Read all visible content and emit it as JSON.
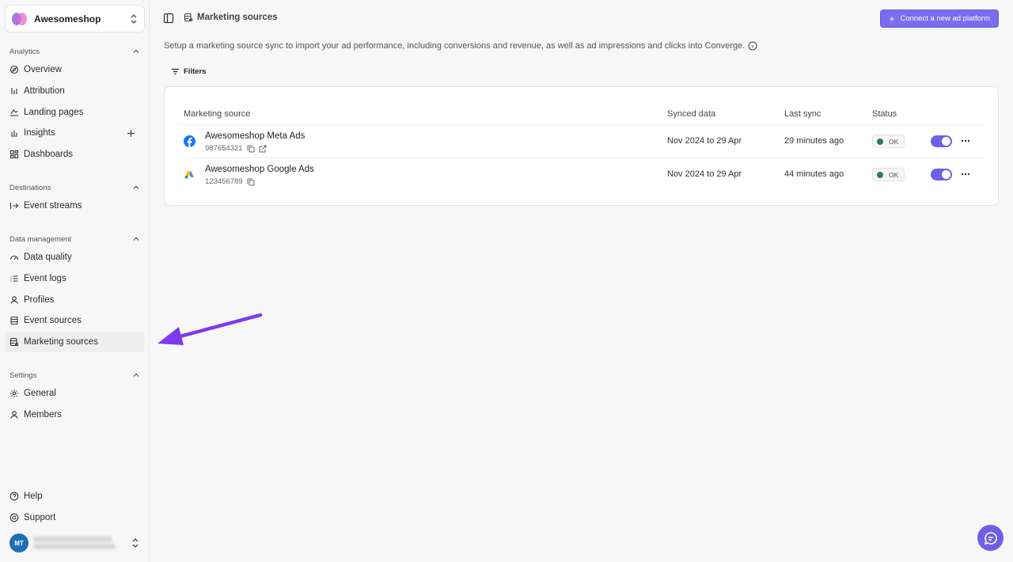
{
  "workspace": {
    "name": "Awesomeshop"
  },
  "sidebar": {
    "sections": [
      {
        "title": "Analytics",
        "items": [
          {
            "label": "Overview",
            "icon": "compass-icon"
          },
          {
            "label": "Attribution",
            "icon": "attribution-icon"
          },
          {
            "label": "Landing pages",
            "icon": "landing-icon"
          },
          {
            "label": "Insights",
            "icon": "bar-chart-icon"
          },
          {
            "label": "Dashboards",
            "icon": "grid-icon"
          }
        ]
      },
      {
        "title": "Destinations",
        "items": [
          {
            "label": "Event streams",
            "icon": "arrow-right-icon"
          }
        ]
      },
      {
        "title": "Data management",
        "items": [
          {
            "label": "Data quality",
            "icon": "gauge-icon"
          },
          {
            "label": "Event logs",
            "icon": "list-icon"
          },
          {
            "label": "Profiles",
            "icon": "user-icon"
          },
          {
            "label": "Event sources",
            "icon": "database-icon"
          },
          {
            "label": "Marketing sources",
            "icon": "database-gear-icon"
          }
        ]
      },
      {
        "title": "Settings",
        "items": [
          {
            "label": "General",
            "icon": "gear-icon"
          },
          {
            "label": "Members",
            "icon": "user-icon"
          }
        ]
      }
    ],
    "footer": {
      "help": "Help",
      "support": "Support",
      "user_initials": "MT"
    }
  },
  "header": {
    "breadcrumb": "Marketing sources",
    "connect_button": "Connect a new ad platform"
  },
  "description": "Setup a marketing source sync to import your ad performance, including conversions and revenue, as well as ad impressions and clicks into Converge.",
  "filters_label": "Filters",
  "table": {
    "columns": [
      "Marketing source",
      "Synced data",
      "Last sync",
      "Status"
    ],
    "rows": [
      {
        "name": "Awesomeshop Meta Ads",
        "id": "987654321",
        "synced": "Nov 2024 to 29 Apr",
        "last_sync": "29 minutes ago",
        "status": "OK",
        "enabled": true,
        "icon": "facebook-icon"
      },
      {
        "name": "Awesomeshop Google Ads",
        "id": "123456789",
        "synced": "Nov 2024 to 29 Apr",
        "last_sync": "44 minutes ago",
        "status": "OK",
        "enabled": true,
        "icon": "google-ads-icon"
      }
    ]
  },
  "colors": {
    "accent": "#7b6cf0",
    "status_ok": "#2e7d4f",
    "annotation_arrow": "#7c3aed"
  }
}
